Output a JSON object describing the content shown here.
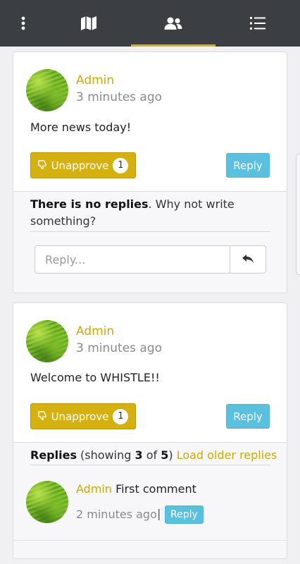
{
  "nav": {
    "items": [
      {
        "name": "more-options",
        "icon": "vertical-dots-icon",
        "active": false
      },
      {
        "name": "map",
        "icon": "map-icon",
        "active": false
      },
      {
        "name": "users",
        "icon": "users-icon",
        "active": true
      },
      {
        "name": "list",
        "icon": "list-icon",
        "active": false
      }
    ],
    "active_color": "#d4b010"
  },
  "posts": [
    {
      "author": "Admin",
      "time": "3 minutes ago",
      "body": "More news today!",
      "unapprove_label": "Unapprove",
      "unapprove_count": "1",
      "reply_label": "Reply",
      "no_replies_bold": "There is no replies",
      "no_replies_rest": ". Why not write something?",
      "reply_input_placeholder": "Reply..."
    },
    {
      "author": "Admin",
      "time": "3 minutes ago",
      "body": "Welcome to WHISTLE!!",
      "unapprove_label": "Unapprove",
      "unapprove_count": "1",
      "reply_label": "Reply",
      "replies_label": "Replies",
      "showing_prefix": " (showing ",
      "showing_count": "3",
      "showing_of": " of ",
      "showing_total": "5",
      "showing_suffix": ")",
      "load_older_label": "Load older replies",
      "replies": [
        {
          "author": "Admin",
          "text": "First comment",
          "time": "2 minutes ago",
          "separator": "|",
          "reply_label": "Reply"
        }
      ]
    }
  ],
  "colors": {
    "topbar": "#3b3f44",
    "accent": "#d4b010",
    "reply_button": "#5bc0de"
  }
}
